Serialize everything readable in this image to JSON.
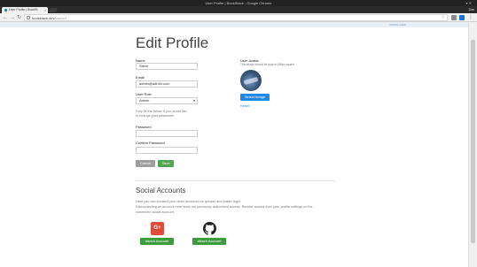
{
  "window": {
    "title": "User Profile | BookStack - Google Chrome",
    "controls": "▾ ✕",
    "user": "Dan"
  },
  "tab": {
    "label": "User Profile | BookSt",
    "close": "×"
  },
  "toolbar": {
    "back": "←",
    "forward": "→",
    "reload": "↻",
    "url_host": "bookstack.dev/",
    "url_path": "users/1",
    "menu": "⋮"
  },
  "header": {
    "link": "· ADMIN USER"
  },
  "page": {
    "title": "Edit Profile"
  },
  "form": {
    "name_label": "Name",
    "name_value": "Steve",
    "email_label": "Email",
    "email_value": "admin@admin.com",
    "role_label": "User Role",
    "role_value": "Admin",
    "password_note_line1": "Only fill the below if you would like",
    "password_note_line2": "to change your password:",
    "password_label": "Password",
    "password_value": "",
    "confirm_label": "Confirm Password",
    "confirm_value": "",
    "cancel_label": "Cancel",
    "save_label": "Save"
  },
  "avatar_section": {
    "label": "User Avatar",
    "note": "This image should be approx 256px square.",
    "select_label": "Select Image",
    "reset_label": "Reset"
  },
  "social": {
    "title": "Social Accounts",
    "desc_line1": "Here you can connect your other accounts for quicker and easier login.",
    "desc_line2": "Disconnecting an account here does not previously authorized access. Revoke access from your profile settings on the",
    "desc_line3": "connected social account.",
    "google_letter": "G+",
    "google_button": "Attach Account",
    "github_button": "Attach Account"
  },
  "colors": {
    "save": "#52a552",
    "select_image": "#1e88e5",
    "attach": "#3c9b3c",
    "google": "#dd4b39"
  },
  "icons": [
    "lock-icon",
    "star-icon",
    "google-plus-icon",
    "github-icon"
  ]
}
